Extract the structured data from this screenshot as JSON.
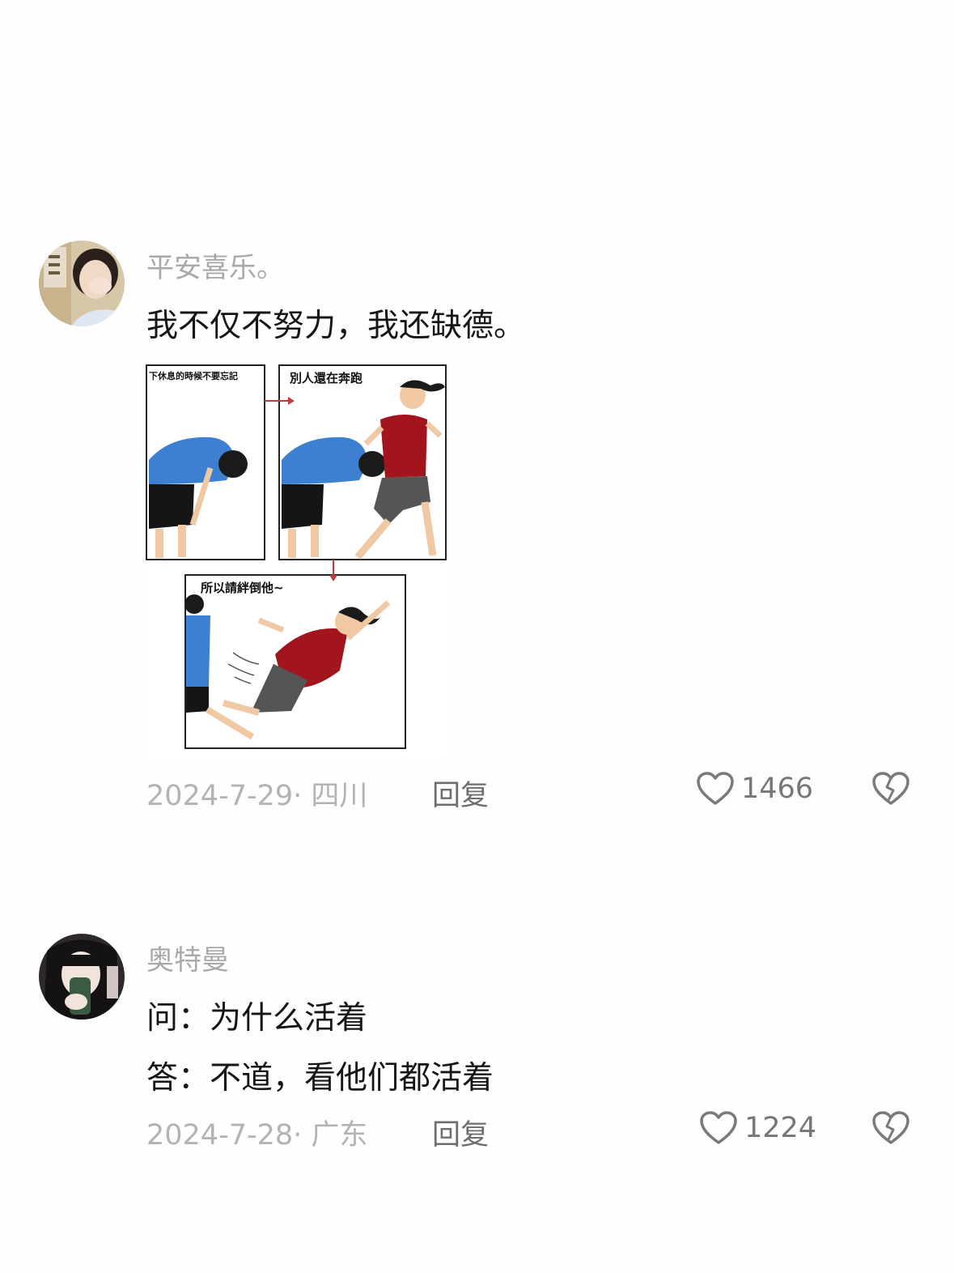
{
  "comments": [
    {
      "username": "平安喜乐。",
      "lines": [
        "我不仅不努力，我还缺德。"
      ],
      "date": "2024-7-29",
      "location": "四川",
      "reply_label": "回复",
      "likes": "1466",
      "image": {
        "panel1_caption": "下休息的時候不要忘記",
        "panel2_caption": "別人還在奔跑",
        "panel3_caption": "所以請絆倒他~"
      }
    },
    {
      "username": "奥特曼",
      "lines": [
        "问：为什么活着",
        "答：不道，看他们都活着"
      ],
      "date": "2024-7-28",
      "location": "广东",
      "reply_label": "回复",
      "likes": "1224"
    }
  ],
  "icons": {
    "like": "heart-outline-icon",
    "dislike": "broken-heart-icon"
  },
  "colors": {
    "username": "#a9a9a9",
    "body_text": "#161616",
    "meta": "#b3b3b3",
    "shirt_blue": "#3d7fd1",
    "shirt_red": "#a3151c"
  }
}
